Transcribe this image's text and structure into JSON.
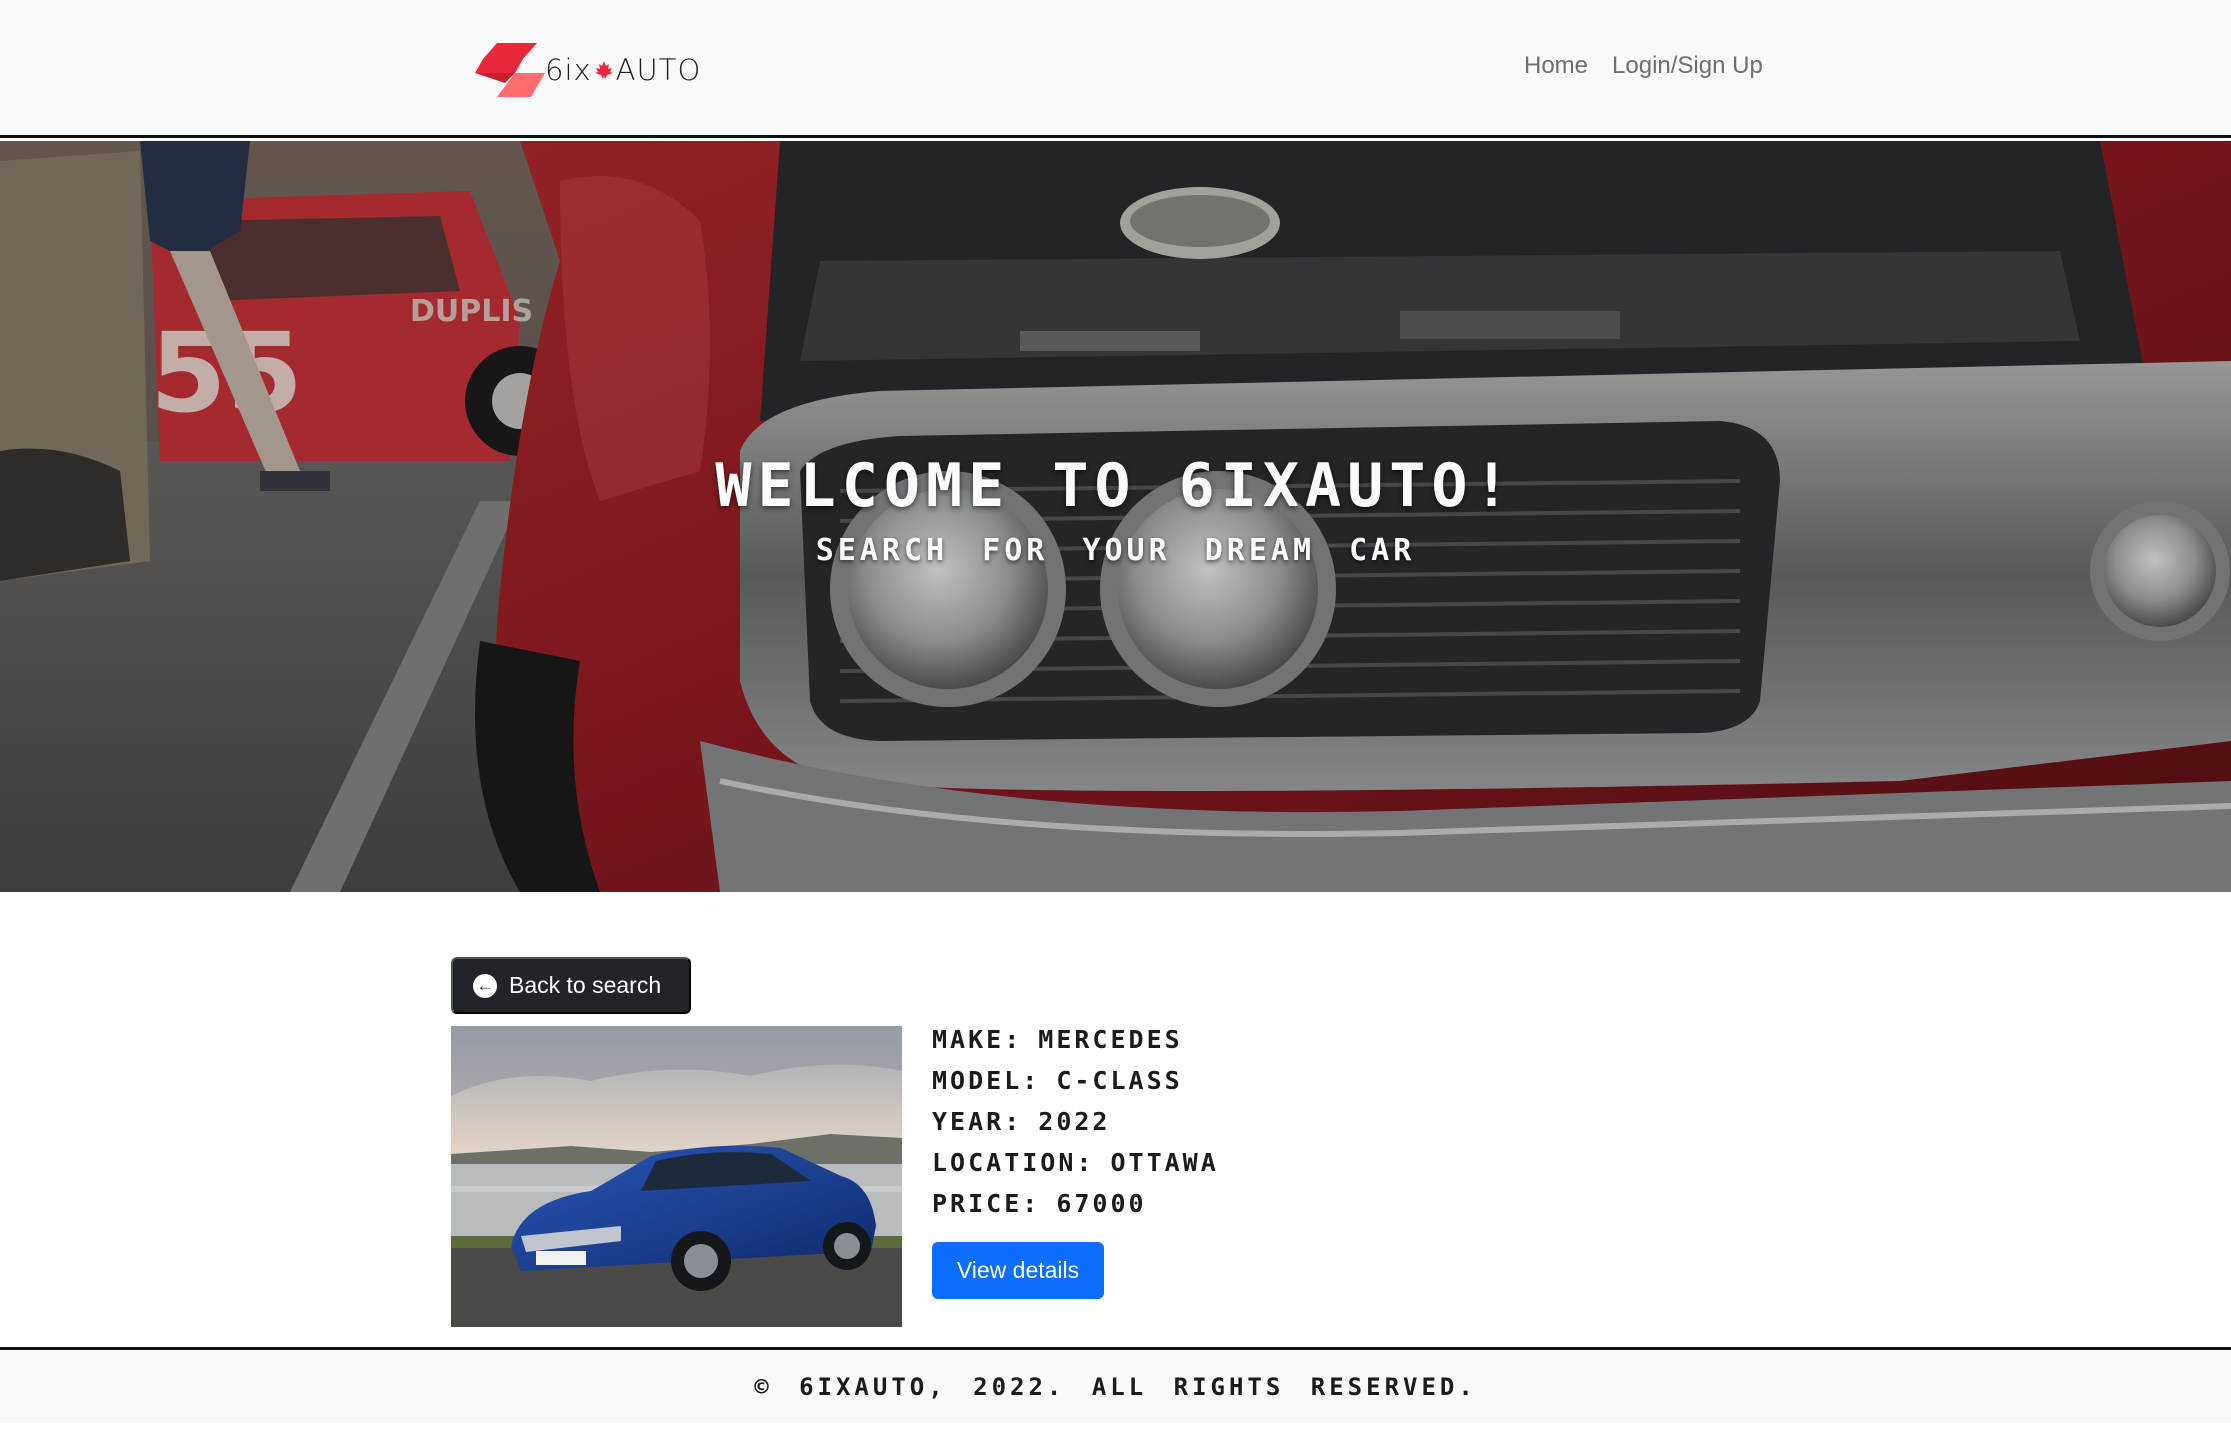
{
  "nav": {
    "brand_text_left": "6ix",
    "brand_text_right": "AUTO",
    "links": [
      {
        "label": "Home"
      },
      {
        "label": "Login/Sign Up"
      }
    ]
  },
  "hero": {
    "title": "WELCOME TO 6IXAUTO!",
    "subtitle": "SEARCH FOR YOUR DREAM CAR"
  },
  "listing": {
    "back_label": "Back to search",
    "specs": [
      {
        "label": "MAKE:",
        "value": "MERCEDES"
      },
      {
        "label": "MODEL:",
        "value": "C-CLASS"
      },
      {
        "label": "YEAR:",
        "value": "2022"
      },
      {
        "label": "LOCATION:",
        "value": "OTTAWA"
      },
      {
        "label": "PRICE:",
        "value": "67000"
      }
    ],
    "view_label": "View details"
  },
  "footer": {
    "text": "© 6IXAUTO, 2022. ALL RIGHTS RESERVED."
  },
  "colors": {
    "brand_red": "#ef3b3b",
    "primary_button": "#0d6efd",
    "dark_button": "#212529",
    "navbar_bg": "#f8f9fa"
  }
}
